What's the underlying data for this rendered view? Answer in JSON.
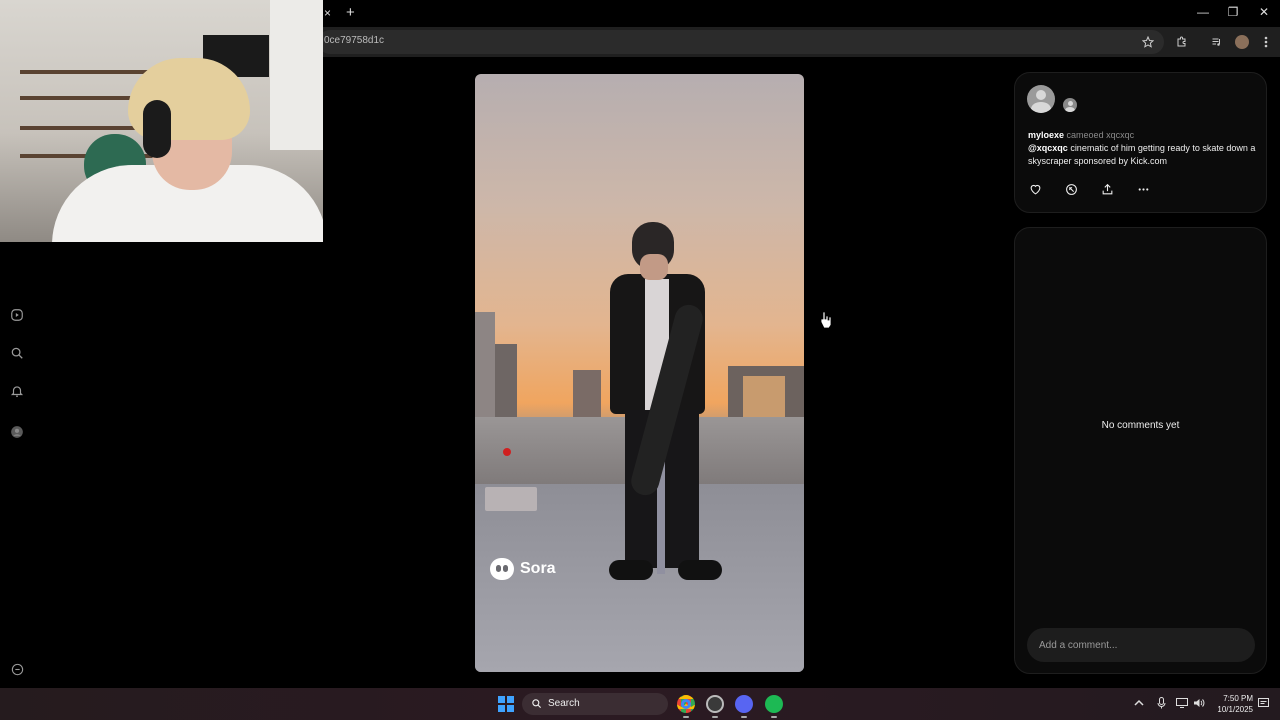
{
  "browser": {
    "tab_close_glyph": "×",
    "new_tab_glyph": "+",
    "url_fragment": "0ce79758d1c",
    "window_controls": {
      "minimize": "—",
      "maximize": "❐",
      "close": "✕"
    }
  },
  "webcam": {
    "present": true
  },
  "left_rail": {
    "items": [
      {
        "icon": "play-circle-icon"
      },
      {
        "icon": "search-icon"
      },
      {
        "icon": "bell-icon"
      },
      {
        "icon": "profile-icon"
      },
      {
        "icon": "minus-circle-icon"
      }
    ]
  },
  "video": {
    "watermark": "Sora"
  },
  "post": {
    "username": "myloexe",
    "action": "cameoed xqcxqc",
    "mention": "@xqcxqc",
    "caption": "cinematic of him getting ready to skate down a skyscraper sponsored by Kick.com",
    "actions": [
      "heart-icon",
      "remix-icon",
      "share-icon",
      "more-icon"
    ]
  },
  "comments": {
    "empty_text": "No comments yet",
    "input_placeholder": "Add a comment..."
  },
  "taskbar": {
    "search_label": "Search",
    "time": "7:50 PM",
    "date": "10/1/2025"
  },
  "colors": {
    "background": "#000000",
    "panel": "#0b0b0b",
    "panel_border": "#1e1e1e",
    "muted_text": "#8a8a8a",
    "taskbar": "#2b1a22",
    "start_blue": "#3fa3ff"
  }
}
